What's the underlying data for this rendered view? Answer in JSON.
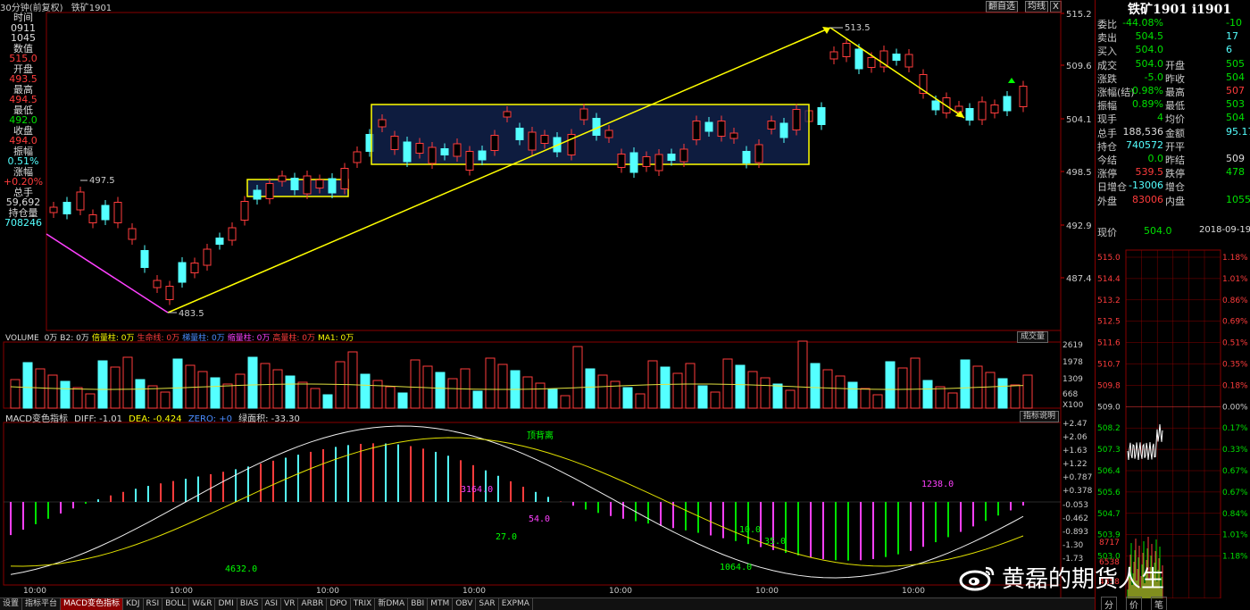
{
  "header": {
    "period": "30分钟(前复权)",
    "symbol": "铁矿1901",
    "btn_overlay": "翻自选",
    "btn_ma": "均线",
    "btn_x": "X"
  },
  "left_info": [
    {
      "text": "时间",
      "color": "white"
    },
    {
      "text": "0911",
      "color": "white"
    },
    {
      "text": "1045",
      "color": "white"
    },
    {
      "text": "数值",
      "color": "white"
    },
    {
      "text": "515.0",
      "color": "red"
    },
    {
      "text": "开盘",
      "color": "white"
    },
    {
      "text": "493.5",
      "color": "red"
    },
    {
      "text": "最高",
      "color": "white"
    },
    {
      "text": "494.5",
      "color": "red"
    },
    {
      "text": "最低",
      "color": "white"
    },
    {
      "text": "492.0",
      "color": "green"
    },
    {
      "text": "收盘",
      "color": "white"
    },
    {
      "text": "494.0",
      "color": "red"
    },
    {
      "text": "振幅",
      "color": "white"
    },
    {
      "text": "0.51%",
      "color": "cyan"
    },
    {
      "text": "涨幅",
      "color": "white"
    },
    {
      "text": "+0.20%",
      "color": "red"
    },
    {
      "text": "总手",
      "color": "white"
    },
    {
      "text": "59,692",
      "color": "white"
    },
    {
      "text": "持仓量",
      "color": "white"
    },
    {
      "text": "708246",
      "color": "cyan"
    }
  ],
  "price_axis": [
    "515.2",
    "509.6",
    "504.1",
    "498.5",
    "492.9",
    "487.4"
  ],
  "annotations": {
    "high_label": "513.5",
    "low_label": "483.5",
    "mid_label": "497.5"
  },
  "volume": {
    "title": "VOLUME",
    "items": [
      {
        "text": "0万",
        "color": "white"
      },
      {
        "text": "B2: 0万",
        "color": "white"
      },
      {
        "text": "倍量柱: 0万",
        "color": "yellow"
      },
      {
        "text": "生命线: 0万",
        "color": "red"
      },
      {
        "text": "梯量柱: 0万",
        "color": "blue"
      },
      {
        "text": "缩量柱: 0万",
        "color": "magenta"
      },
      {
        "text": "高量柱: 0万",
        "color": "red"
      },
      {
        "text": "MA1: 0万",
        "color": "yellow"
      }
    ],
    "btn": "成交量",
    "axis": [
      "2619",
      "1978",
      "1309",
      "668",
      "X100"
    ]
  },
  "macd": {
    "title": "MACD变色指标",
    "diff": "DIFF: -1.01",
    "dea": "DEA: -0.424",
    "zero": "ZERO: +0",
    "area": "绿面积: -33.30",
    "btn": "指标说明",
    "axis": [
      "+2.47",
      "+2.06",
      "+1.63",
      "+1.22",
      "+0.787",
      "+0.378",
      "-0.053",
      "-0.462",
      "-0.893",
      "-1.30",
      "-1.73"
    ],
    "labels": [
      {
        "text": "顶背离",
        "color": "#00ff00"
      },
      {
        "text": "3164.0",
        "color": "#ff40ff"
      },
      {
        "text": "54.0",
        "color": "#ff40ff"
      },
      {
        "text": "27.0",
        "color": "#00ff00"
      },
      {
        "text": "10.0",
        "color": "#00ff00"
      },
      {
        "text": "35.0",
        "color": "#00ff00"
      },
      {
        "text": "1238.0",
        "color": "#ff40ff"
      },
      {
        "text": "1064.0",
        "color": "#00ff00"
      },
      {
        "text": "4632.0",
        "color": "#00ff00"
      }
    ]
  },
  "time_axis": [
    "10:00",
    "10:00",
    "10:00",
    "10:00",
    "10:00",
    "10:00",
    "10:00"
  ],
  "right_panel": {
    "title": "铁矿1901 i1901",
    "rows": [
      {
        "k": "委比",
        "v": "-44.08%",
        "vc": "green",
        "k2": "",
        "v2": "-10",
        "v2c": "green"
      },
      {
        "k": "卖出",
        "v": "504.5",
        "vc": "green",
        "k2": "",
        "v2": "17",
        "v2c": "cyan"
      },
      {
        "k": "买入",
        "v": "504.0",
        "vc": "green",
        "k2": "",
        "v2": "6",
        "v2c": "cyan"
      },
      {
        "k": "成交",
        "v": "504.0",
        "vc": "green",
        "k2": "开盘",
        "v2": "505",
        "v2c": "green"
      },
      {
        "k": "涨跌",
        "v": "-5.0",
        "vc": "green",
        "k2": "昨收",
        "v2": "504",
        "v2c": "green"
      },
      {
        "k": "涨幅(结)",
        "v": "-0.98%",
        "vc": "green",
        "k2": "最高",
        "v2": "507",
        "v2c": "red"
      },
      {
        "k": "振幅",
        "v": "0.89%",
        "vc": "green",
        "k2": "最低",
        "v2": "503",
        "v2c": "green"
      },
      {
        "k": "现手",
        "v": "4",
        "vc": "green",
        "k2": "均价",
        "v2": "504",
        "v2c": "green"
      },
      {
        "k": "总手",
        "v": "188,536",
        "vc": "white",
        "k2": "金额",
        "v2": "95.17",
        "v2c": "cyan"
      },
      {
        "k": "持仓",
        "v": "740572",
        "vc": "cyan",
        "k2": "开平",
        "v2": "",
        "v2c": "white"
      },
      {
        "k": "今结",
        "v": "0.0",
        "vc": "green",
        "k2": "昨结",
        "v2": "509",
        "v2c": "white"
      },
      {
        "k": "涨停",
        "v": "539.5",
        "vc": "red",
        "k2": "跌停",
        "v2": "478",
        "v2c": "green"
      },
      {
        "k": "日增仓",
        "v": "-13006",
        "vc": "cyan",
        "k2": "增仓",
        "v2": "",
        "v2c": "white"
      },
      {
        "k": "外盘",
        "v": "83006",
        "vc": "red",
        "k2": "内盘",
        "v2": "1055",
        "v2c": "green"
      }
    ],
    "now_label": "现价",
    "now_value": "504.0",
    "date": "2018-09-19,",
    "mini_axis_left": [
      "515.0",
      "514.4",
      "513.2",
      "512.5",
      "511.6",
      "510.7",
      "509.8",
      "509.0",
      "508.2",
      "507.3",
      "506.4",
      "505.6",
      "504.7",
      "503.9",
      "503.0"
    ],
    "mini_axis_right": [
      "1.18%",
      "1.01%",
      "0.86%",
      "0.69%",
      "0.51%",
      "0.35%",
      "0.18%",
      "0.00%",
      "0.17%",
      "0.33%",
      "0.67%",
      "0.67%",
      "0.84%",
      "1.01%",
      "1.18%"
    ],
    "mini_vol": [
      "8717",
      "6538",
      "4358"
    ],
    "bottom_btns": [
      "分",
      "价",
      "笔"
    ]
  },
  "bottom_tabs": [
    "设置",
    "指标平台",
    "MACD变色指标",
    "KDJ",
    "RSI",
    "BOLL",
    "W&R",
    "DMI",
    "BIAS",
    "ASI",
    "VR",
    "ARBR",
    "DPO",
    "TRIX",
    "新DMA",
    "BBI",
    "MTM",
    "OBV",
    "SAR",
    "EXPMA"
  ],
  "active_tab": "MACD变色指标",
  "watermark": "黄磊的期货人生"
}
